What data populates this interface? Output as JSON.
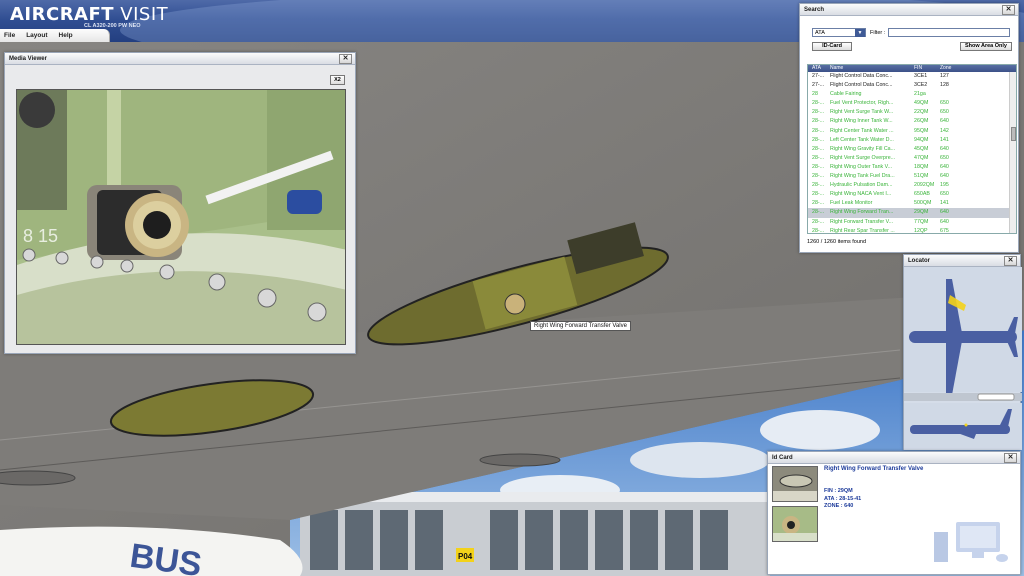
{
  "app": {
    "title_bold": "AIRCRAFT",
    "title_thin": " VISIT",
    "subtitle": "CL A320-200 PW NEO"
  },
  "menu": [
    "File",
    "Layout",
    "Help"
  ],
  "media_viewer": {
    "title": "Media Viewer",
    "close": "✕",
    "zoom_label": "X2",
    "photo_text": "8 15"
  },
  "tooltip": "Right Wing Forward Transfer Valve",
  "scene": {
    "sign_text": "P04"
  },
  "search": {
    "title": "Search",
    "close": "✕",
    "selector_value": "ATA",
    "filter_label": "Filter :",
    "filter_value": "",
    "idcard_button": "ID-Card",
    "show_area_button": "Show Area Only",
    "columns": [
      "ATA",
      "Name",
      "FIN",
      "Zone"
    ],
    "rows": [
      {
        "ata": "27-...",
        "name": "Flight Control Data Conc...",
        "fin": "3CE1",
        "zone": "127",
        "color": "#1a1a1a"
      },
      {
        "ata": "27-...",
        "name": "Flight Control Data Conc...",
        "fin": "3CE2",
        "zone": "128",
        "color": "#1a1a1a"
      },
      {
        "ata": "28",
        "name": "Cable Fairing",
        "fin": "21ga",
        "zone": "",
        "color": "#3ab43a"
      },
      {
        "ata": "28-...",
        "name": "Fuel Vent Protector, Righ...",
        "fin": "49QM",
        "zone": "650",
        "color": "#3ab43a"
      },
      {
        "ata": "28-...",
        "name": "Right Vent Surge Tank W...",
        "fin": "22QM",
        "zone": "650",
        "color": "#3ab43a"
      },
      {
        "ata": "28-...",
        "name": "Right Wing Inner Tank W...",
        "fin": "26QM",
        "zone": "640",
        "color": "#3ab43a"
      },
      {
        "ata": "28-...",
        "name": "Right Center Tank Water ...",
        "fin": "95QM",
        "zone": "142",
        "color": "#3ab43a"
      },
      {
        "ata": "28-...",
        "name": "Left Center Tank Water D...",
        "fin": "94QM",
        "zone": "141",
        "color": "#3ab43a"
      },
      {
        "ata": "28-...",
        "name": "Right Wing Gravity Fill Ca...",
        "fin": "45QM",
        "zone": "640",
        "color": "#3ab43a"
      },
      {
        "ata": "28-...",
        "name": "Right Vent Surge Overpre...",
        "fin": "47QM",
        "zone": "650",
        "color": "#3ab43a"
      },
      {
        "ata": "28-...",
        "name": "Right Wing Outer Tank V...",
        "fin": "18QM",
        "zone": "640",
        "color": "#3ab43a"
      },
      {
        "ata": "28-...",
        "name": "Right Wing Tank Fuel Dra...",
        "fin": "51QM",
        "zone": "640",
        "color": "#3ab43a"
      },
      {
        "ata": "28-...",
        "name": "Hydraulic Pulsation Dam...",
        "fin": "2092QM",
        "zone": "195",
        "color": "#3ab43a"
      },
      {
        "ata": "28-...",
        "name": "Right Wing NACA Vent I...",
        "fin": "650AB",
        "zone": "650",
        "color": "#3ab43a"
      },
      {
        "ata": "28-...",
        "name": "Fuel Leak Monitor",
        "fin": "500QM",
        "zone": "141",
        "color": "#3ab43a"
      },
      {
        "ata": "28-...",
        "name": "Right Wing Forward Tran...",
        "fin": "29QM",
        "zone": "640",
        "color": "#3ab43a",
        "selected": true
      },
      {
        "ata": "28-...",
        "name": "Right Forward Transfer V...",
        "fin": "77QM",
        "zone": "640",
        "color": "#3ab43a"
      },
      {
        "ata": "28-...",
        "name": "Right Rear Spar Transfer ...",
        "fin": "12QP",
        "zone": "675",
        "color": "#3ab43a"
      }
    ],
    "count": "1260 / 1260 items found"
  },
  "locator": {
    "title": "Locator",
    "close": "✕"
  },
  "id_card": {
    "title": "Id Card",
    "close": "✕",
    "name": "Right Wing Forward Transfer Valve",
    "fin": "FIN : 29QM",
    "ata": "ATA : 28-15-41",
    "zone": "ZONE : 640"
  },
  "colors": {
    "header": "#314f93",
    "green_item": "#3ab43a",
    "id_text": "#1c3a9a",
    "aircraft": "#4a5fa2"
  }
}
